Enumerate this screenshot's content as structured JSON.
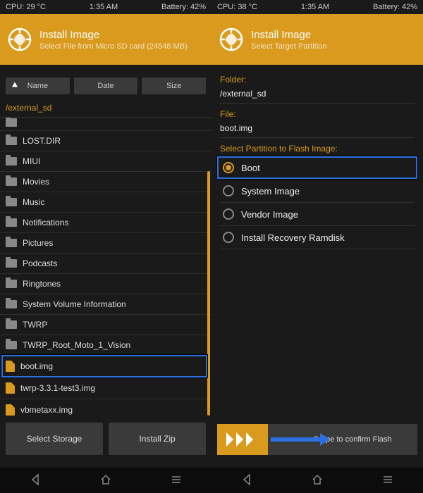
{
  "left": {
    "status": {
      "cpu": "CPU: 29 °C",
      "time": "1:35 AM",
      "battery": "Battery: 42%"
    },
    "header": {
      "title": "Install Image",
      "subtitle": "Select File from Micro SD card (24548 MB)"
    },
    "sort": {
      "name": "Name",
      "date": "Date",
      "size": "Size"
    },
    "path": "/external_sd",
    "items": [
      {
        "label": "LOST.DIR",
        "type": "folder"
      },
      {
        "label": "MIUI",
        "type": "folder"
      },
      {
        "label": "Movies",
        "type": "folder"
      },
      {
        "label": "Music",
        "type": "folder"
      },
      {
        "label": "Notifications",
        "type": "folder"
      },
      {
        "label": "Pictures",
        "type": "folder"
      },
      {
        "label": "Podcasts",
        "type": "folder"
      },
      {
        "label": "Ringtones",
        "type": "folder"
      },
      {
        "label": "System Volume Information",
        "type": "folder"
      },
      {
        "label": "TWRP",
        "type": "folder"
      },
      {
        "label": "TWRP_Root_Moto_1_Vision",
        "type": "folder"
      },
      {
        "label": "boot.img",
        "type": "file"
      },
      {
        "label": "twrp-3.3.1-test3.img",
        "type": "file"
      },
      {
        "label": "vbmetaxx.img",
        "type": "file"
      }
    ],
    "buttons": {
      "storage": "Select Storage",
      "zip": "Install Zip"
    }
  },
  "right": {
    "status": {
      "cpu": "CPU: 38 °C",
      "time": "1:35 AM",
      "battery": "Battery: 42%"
    },
    "header": {
      "title": "Install Image",
      "subtitle": "Select Target Partition"
    },
    "folder_label": "Folder:",
    "folder_value": "/external_sd",
    "file_label": "File:",
    "file_value": "boot.img",
    "partition_label": "Select Partition to Flash Image:",
    "partitions": [
      {
        "label": "Boot",
        "selected": true
      },
      {
        "label": "System Image",
        "selected": false
      },
      {
        "label": "Vendor Image",
        "selected": false
      },
      {
        "label": "Install Recovery Ramdisk",
        "selected": false
      }
    ],
    "swipe": "Swipe to confirm Flash"
  }
}
